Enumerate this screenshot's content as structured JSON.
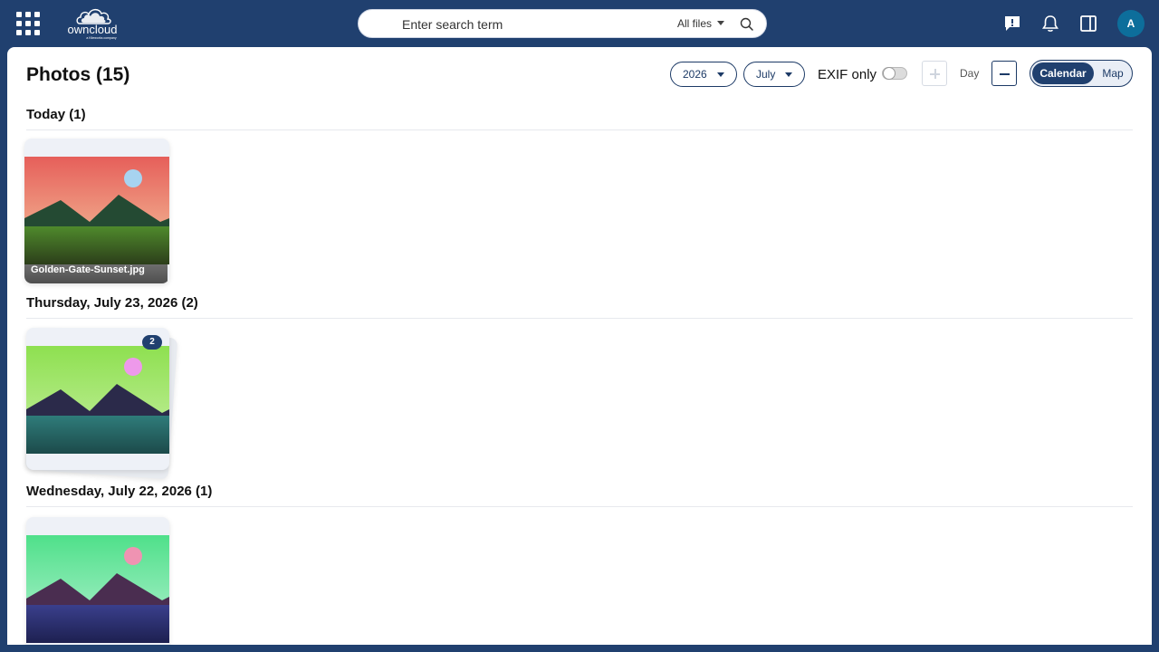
{
  "header": {
    "search_placeholder": "Enter search term",
    "search_scope": "All files",
    "avatar_initial": "A"
  },
  "photos": {
    "title": "Photos (15)",
    "year_filter": "2026",
    "month_filter": "July",
    "exif_label": "EXIF only",
    "exif_enabled": false,
    "zoom_label": "Day",
    "view_calendar": "Calendar",
    "view_map": "Map",
    "active_view": "Calendar"
  },
  "groups": [
    {
      "heading": "Today (1)",
      "photos": [
        {
          "filename": "Golden-Gate-Sunset.jpg"
        }
      ]
    },
    {
      "heading": "Thursday, July 23, 2026 (2)",
      "photos": [
        {
          "stack_count": "2"
        }
      ]
    },
    {
      "heading": "Wednesday, July 22, 2026 (1)",
      "photos": [
        {}
      ]
    }
  ],
  "colors": {
    "brand": "#20406f",
    "accent_text": "#1c3a66"
  }
}
